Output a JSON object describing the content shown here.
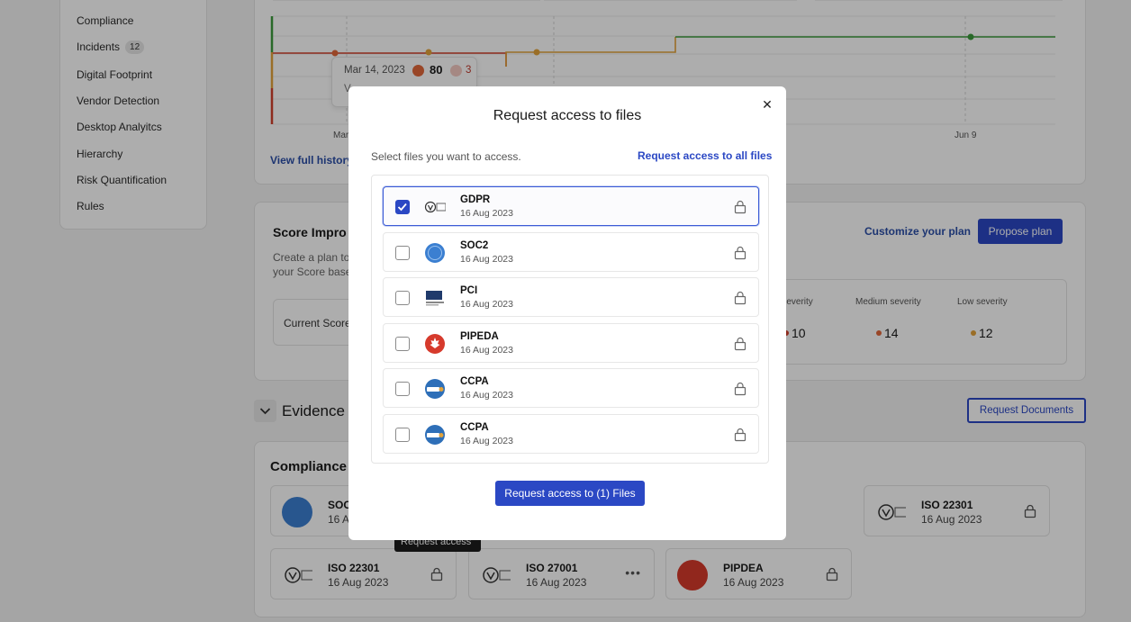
{
  "sidebar": {
    "items": [
      {
        "label": "Compliance"
      },
      {
        "label": "Incidents",
        "badge": "12"
      },
      {
        "label": "Digital Footprint"
      },
      {
        "label": "Vendor Detection"
      },
      {
        "label": "Desktop Analyitcs"
      },
      {
        "label": "Hierarchy"
      },
      {
        "label": "Risk Quantification"
      },
      {
        "label": "Rules"
      }
    ]
  },
  "history_chart": {
    "tooltip": {
      "date": "Mar 14, 2023",
      "score": "80",
      "delta": "3",
      "second_line": "V"
    },
    "x_labels": [
      "Mar",
      "Jun 9"
    ],
    "view_full_history": "View full history"
  },
  "score_improvement": {
    "title": "Score Impro",
    "description": "Create a plan to your Score base",
    "current_score_label": "Current Score",
    "customize_link": "Customize your plan",
    "propose_button": "Propose plan",
    "severities": [
      {
        "label": "n severity",
        "value": "10",
        "color": "#d0402b"
      },
      {
        "label": "Medium severity",
        "value": "14",
        "color": "#e2673a"
      },
      {
        "label": "Low severity",
        "value": "12",
        "color": "#e3a33a"
      }
    ]
  },
  "evidence": {
    "title": "Evidence",
    "request_documents_button": "Request Documents"
  },
  "compliance": {
    "title": "Compliance c",
    "tooltip": "Request access",
    "files": [
      {
        "name": "SOC",
        "date": "16 A",
        "icon": "aicpa-soc-icon"
      },
      {
        "name": "ISO 22301",
        "date": "16 Aug 2023",
        "icon": "bsi-icon"
      },
      {
        "name": "ISO 22301",
        "date": "16 Aug 2023",
        "icon": "bsi-icon"
      },
      {
        "name": "ISO 27001",
        "date": "16 Aug 2023",
        "icon": "bsi-icon"
      },
      {
        "name": "PIPDEA",
        "date": "16 Aug 2023",
        "icon": "maple-leaf-icon"
      }
    ]
  },
  "modal": {
    "title": "Request access to files",
    "subtitle": "Select files you want to access.",
    "request_all": "Request access to all files",
    "files": [
      {
        "name": "GDPR",
        "date": "16 Aug 2023",
        "icon": "bsi-icon",
        "checked": true
      },
      {
        "name": "SOC2",
        "date": "16 Aug 2023",
        "icon": "aicpa-soc-icon",
        "checked": false
      },
      {
        "name": "PCI",
        "date": "16 Aug 2023",
        "icon": "pci-icon",
        "checked": false
      },
      {
        "name": "PIPEDA",
        "date": "16 Aug 2023",
        "icon": "maple-leaf-icon",
        "checked": false
      },
      {
        "name": "CCPA",
        "date": "16 Aug 2023",
        "icon": "ccpa-icon",
        "checked": false
      },
      {
        "name": "CCPA",
        "date": "16 Aug 2023",
        "icon": "ccpa-icon",
        "checked": false
      }
    ],
    "submit_button": "Request access to (1) Files",
    "close_icon": "close-icon"
  },
  "colors": {
    "primary": "#2b48c4",
    "link": "#2b4fa8"
  }
}
